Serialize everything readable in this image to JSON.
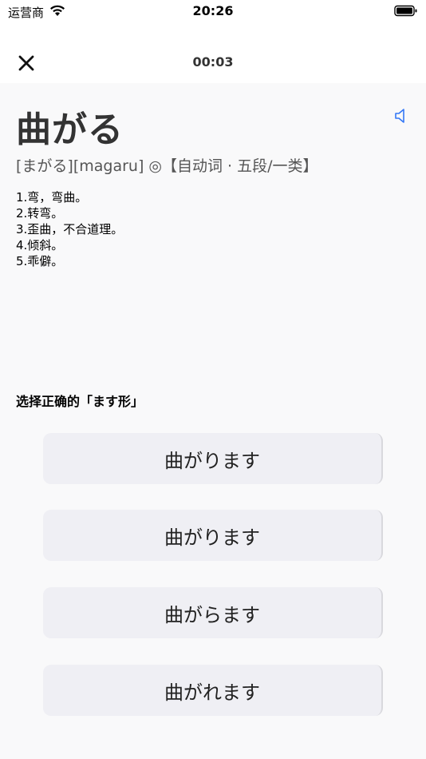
{
  "status_bar": {
    "carrier": "运营商",
    "time": "20:26"
  },
  "nav": {
    "timer": "00:03"
  },
  "word": {
    "headword": "曲がる",
    "reading": "[まがる][magaru] ◎【自动词 · 五段/一类】",
    "definitions": [
      "1.弯，弯曲。",
      "2.转弯。",
      "3.歪曲，不合道理。",
      "4.倾斜。",
      "5.乖僻。"
    ]
  },
  "quiz": {
    "question": "选择正确的「ます形」",
    "options": [
      "曲がります",
      "曲がります",
      "曲がらます",
      "曲がれます"
    ]
  },
  "colors": {
    "accent": "#3478f6",
    "option_bg": "#efeff4"
  },
  "icons": {
    "close": "close-icon",
    "speaker": "speaker-icon",
    "wifi": "wifi-icon",
    "battery": "battery-icon"
  }
}
